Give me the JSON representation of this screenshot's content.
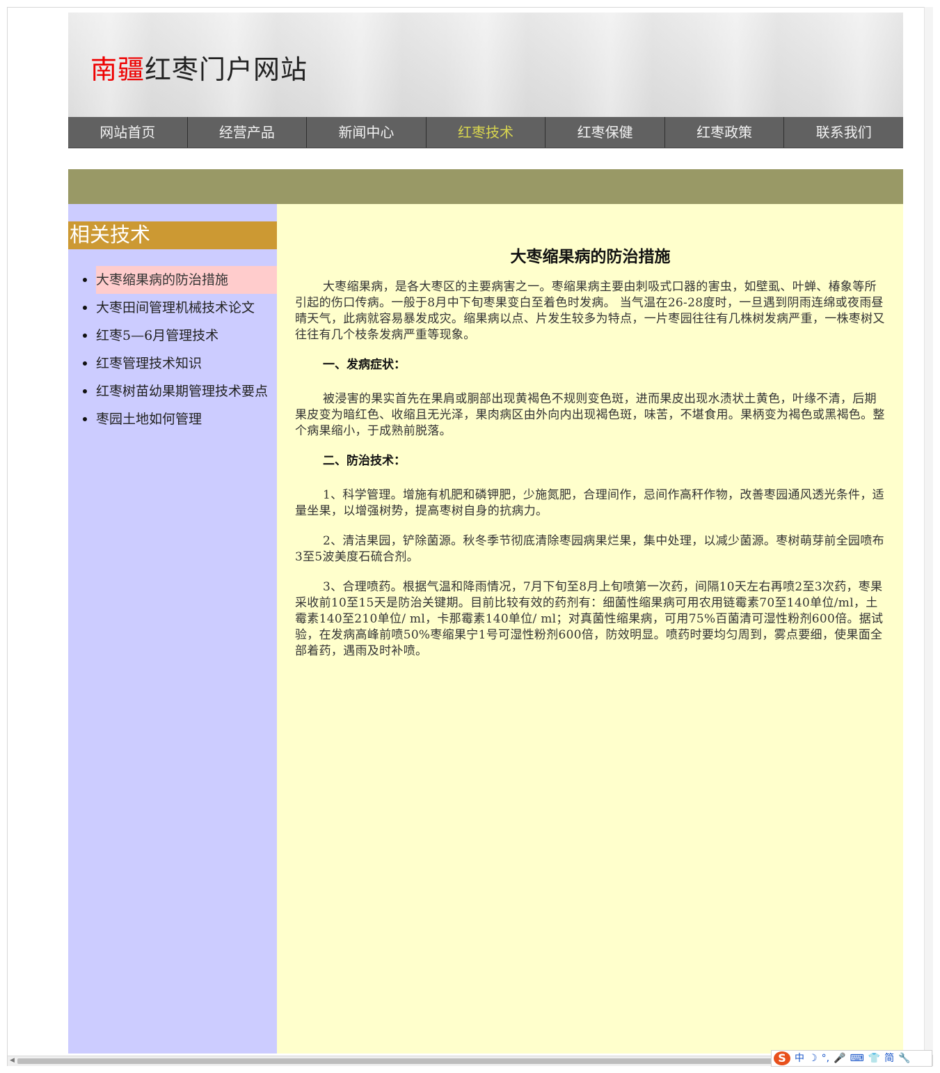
{
  "site": {
    "title_red": "南疆",
    "title_rest": "红枣门户网站"
  },
  "nav": {
    "items": [
      {
        "label": "网站首页"
      },
      {
        "label": "经营产品"
      },
      {
        "label": "新闻中心"
      },
      {
        "label": "红枣技术",
        "active": true
      },
      {
        "label": "红枣保健"
      },
      {
        "label": "红枣政策"
      },
      {
        "label": "联系我们"
      }
    ]
  },
  "sidebar": {
    "title": "相关技术",
    "items": [
      {
        "label": "大枣缩果病的防治措施",
        "active": true
      },
      {
        "label": "大枣田间管理机械技术论文"
      },
      {
        "label": "红枣5—6月管理技术"
      },
      {
        "label": "红枣管理技术知识"
      },
      {
        "label": "红枣树苗幼果期管理技术要点"
      },
      {
        "label": "枣园土地如何管理"
      }
    ]
  },
  "article": {
    "title": "大枣缩果病的防治措施",
    "p1": "大枣缩果病，是各大枣区的主要病害之一。枣缩果病主要由刺吸式口器的害虫，如壁虱、叶蝉、椿象等所引起的伤口传病。一般于8月中下旬枣果变白至着色时发病。 当气温在26-28度时，一旦遇到阴雨连绵或夜雨昼晴天气，此病就容易暴发成灾。缩果病以点、片发生较多为特点，一片枣园往往有几株树发病严重，一株枣树又往往有几个枝条发病严重等现象。",
    "h1": "一、发病症状：",
    "p2": "被浸害的果实首先在果肩或胴部出现黄褐色不规则变色斑，进而果皮出现水渍状土黄色，叶缘不清，后期果皮变为暗红色、收缩且无光泽，果肉病区由外向内出现褐色斑，味苦，不堪食用。果柄变为褐色或黑褐色。整个病果缩小，于成熟前脱落。",
    "h2": "二、防治技术：",
    "p3": "1、科学管理。增施有机肥和磷钾肥，少施氮肥，合理间作，忌间作高秆作物，改善枣园通风透光条件，适量坐果，以增强树势，提高枣树自身的抗病力。",
    "p4": "2、清洁果园，铲除菌源。秋冬季节彻底清除枣园病果烂果，集中处理，以减少菌源。枣树萌芽前全园喷布3至5波美度石硫合剂。",
    "p5": "3、合理喷药。根据气温和降雨情况，7月下旬至8月上旬喷第一次药，间隔10天左右再喷2至3次药，枣果采收前10至15天是防治关键期。目前比较有效的药剂有：细菌性缩果病可用农用链霉素70至140单位/ml，土霉素140至210单位/ ml，卡那霉素140单位/ ml；对真菌性缩果病，可用75%百菌清可湿性粉剂600倍。据试验，在发病高峰前喷50%枣缩果宁1号可湿性粉剂600倍，防效明显。喷药时要均匀周到，雾点要细，使果面全部着药，遇雨及时补喷。"
  },
  "ime": {
    "logo": "S",
    "buttons": [
      "中",
      "☽",
      "°,",
      "🎤",
      "⌨",
      "👕",
      "简",
      "🔧"
    ]
  },
  "colors": {
    "nav_bg": "#616161",
    "nav_active": "#d9d64f",
    "banner": "#999966",
    "sidebar_bg": "#ccccff",
    "sidebar_title_bg": "#cc9933",
    "sidebar_active_bg": "#ffcccc",
    "content_bg": "#ffffcc",
    "title_red": "#ee0000"
  }
}
